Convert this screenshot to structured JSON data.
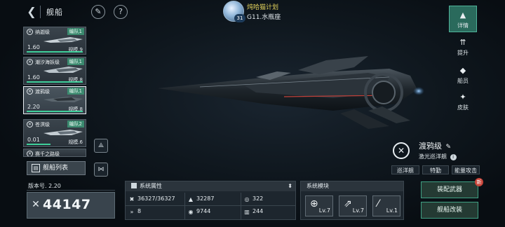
{
  "header": {
    "title": "舰船",
    "player_name": "炖哈猫计划",
    "player_level": "31",
    "galaxy": "G11.水瓶座"
  },
  "ship_list": [
    {
      "name": "纳迦级",
      "fleet": "编队1",
      "level": "1.60",
      "scale": "规模.9"
    },
    {
      "name": "潮汐海妖级",
      "fleet": "编队1",
      "level": "1.60",
      "scale": "规模.8"
    },
    {
      "name": "渡鸦级",
      "fleet": "编队1",
      "level": "2.20",
      "scale": "规模.8"
    },
    {
      "name": "苍溟级",
      "fleet": "编队2",
      "level": "0.01",
      "scale": "规模.6"
    },
    {
      "name": "赛千之路级",
      "fleet": "",
      "level": "",
      "scale": ""
    }
  ],
  "fleet_list_button": "舰船列表",
  "right_nav": [
    {
      "label": "详情",
      "icon": "detail-icon"
    },
    {
      "label": "提升",
      "icon": "upgrade-icon"
    },
    {
      "label": "船员",
      "icon": "crew-icon"
    },
    {
      "label": "皮肤",
      "icon": "skin-icon"
    }
  ],
  "ship_info": {
    "name": "渡鸦级",
    "type": "激光巡洋舰",
    "tags": [
      "巡洋舰",
      "特勤",
      "能量攻击"
    ]
  },
  "version": "版本号. 2.20",
  "power": "44147",
  "attributes": {
    "title": "系统属性",
    "values": [
      "36327/36327",
      "32287",
      "322",
      "8",
      "9744",
      "244"
    ]
  },
  "modules": {
    "title": "系统模块",
    "items": [
      "Lv.7",
      "Lv.7",
      "Lv.1"
    ]
  },
  "actions": {
    "equip": "装配武器",
    "modify": "舰船改装",
    "badge": "新"
  }
}
